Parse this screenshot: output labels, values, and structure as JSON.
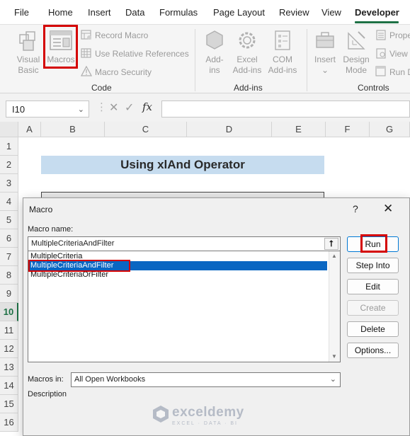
{
  "tabs": [
    "File",
    "Home",
    "Insert",
    "Data",
    "Formulas",
    "Page Layout",
    "Review",
    "View",
    "Developer"
  ],
  "ribbon": {
    "visual_basic": [
      "Visual",
      "Basic"
    ],
    "macros": "Macros",
    "record_macro": "Record Macro",
    "use_relative": "Use Relative References",
    "macro_security": "Macro Security",
    "code_label": "Code",
    "addins": [
      "Add-",
      "ins"
    ],
    "excel_addins": [
      "Excel",
      "Add-ins"
    ],
    "com_addins": [
      "COM",
      "Add-ins"
    ],
    "addins_label": "Add-ins",
    "insert": "Insert",
    "design_mode": [
      "Design",
      "Mode"
    ],
    "properties": "Prope",
    "view_code": "View",
    "run_dialog": "Run D",
    "controls_label": "Controls"
  },
  "formula_bar": {
    "name_box": "I10",
    "fx": "fx"
  },
  "grid": {
    "columns": [
      "A",
      "B",
      "C",
      "D",
      "E",
      "F",
      "G"
    ],
    "rows": [
      "1",
      "2",
      "3",
      "4",
      "5",
      "6",
      "7",
      "8",
      "9",
      "10",
      "11",
      "12",
      "13",
      "14",
      "15",
      "16"
    ],
    "selected_row": "10",
    "title": "Using xlAnd Operator"
  },
  "dialog": {
    "title": "Macro",
    "help": "?",
    "close": "✕",
    "macro_name_label": "Macro name:",
    "macro_name_value": "MultipleCriteriaAndFilter",
    "items": [
      "MultipleCriteria",
      "MultipleCriteriaAndFilter",
      "MultipleCriteriaOrFilter"
    ],
    "selected_index": 1,
    "macros_in_label": "Macros in:",
    "macros_in_value": "All Open Workbooks",
    "description_label": "Description",
    "buttons": {
      "run": "Run",
      "step_into": "Step Into",
      "edit": "Edit",
      "create": "Create",
      "delete": "Delete",
      "options": "Options..."
    }
  },
  "watermark": {
    "name": "exceldemy",
    "tagline": "EXCEL · DATA · BI"
  },
  "colors": {
    "accent_green": "#1e7145",
    "highlight_red": "#d40000",
    "selection_blue": "#0a66c2",
    "title_fill": "#c6dcef"
  }
}
